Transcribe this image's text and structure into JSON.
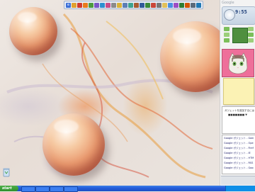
{
  "sidebar": {
    "logo": "Google",
    "clock": {
      "time": "9:55",
      "sub": ""
    },
    "calendar": {
      "day": ""
    },
    "feed": {
      "title": "ガジェットを追加するには",
      "subtitle": "■■■■■■■ ▼"
    },
    "links": [
      "Google ガジェット - Gadget",
      "Google ガジェット - Opera",
      "Google ガジェット - Firefox",
      "Google ガジェット - IE",
      "Google ガジェット - HTML",
      "Google ガジェット - RSS",
      "Google ガジェット - Google"
    ]
  },
  "taskbar": {
    "start_label": "start",
    "clock": ""
  },
  "desktop": {
    "recycle_label": ""
  },
  "colors": {
    "taskbar": "#245edb",
    "start": "#2f8f2c",
    "orb": "#ea9a6f",
    "photo_bg": "#ee6f9a",
    "notes_bg": "#fbf2b4"
  }
}
